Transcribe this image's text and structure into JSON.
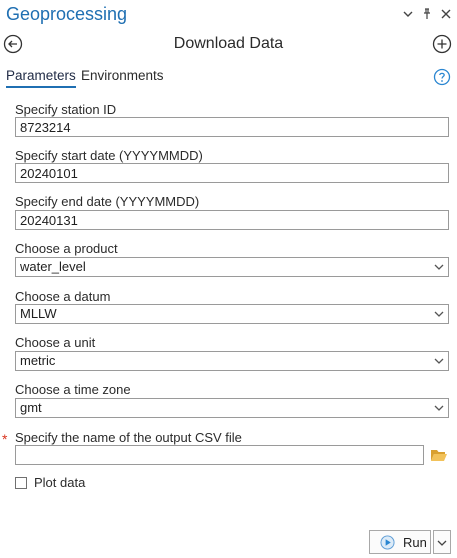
{
  "pane": {
    "title": "Geoprocessing",
    "icons": {
      "options": "chevron-down-icon",
      "pin": "pin-icon",
      "close": "close-icon"
    }
  },
  "tool": {
    "title": "Download Data",
    "icons": {
      "back": "back-arrow-icon",
      "add": "add-circle-icon"
    }
  },
  "tabs": [
    {
      "label": "Parameters",
      "active": true
    },
    {
      "label": "Environments",
      "active": false
    }
  ],
  "help_icon": "help-icon",
  "params": {
    "station_id": {
      "label": "Specify station ID",
      "value": "8723214"
    },
    "start_date": {
      "label": "Specify start date (YYYYMMDD)",
      "value": "20240101"
    },
    "end_date": {
      "label": "Specify end date (YYYYMMDD)",
      "value": "20240131"
    },
    "product": {
      "label": "Choose a product",
      "value": "water_level"
    },
    "datum": {
      "label": "Choose a datum",
      "value": "MLLW"
    },
    "unit": {
      "label": "Choose a unit",
      "value": "metric"
    },
    "time_zone": {
      "label": "Choose a time zone",
      "value": "gmt"
    },
    "output_csv": {
      "label": "Specify the name of the output CSV file",
      "value": "",
      "required": true,
      "required_mark": "*"
    },
    "plot_data": {
      "label": "Plot data",
      "checked": false
    }
  },
  "run_button": {
    "label": "Run"
  },
  "colors": {
    "accent": "#1f6fb2",
    "required": "#d9341f",
    "folder": "#e8b64a"
  }
}
